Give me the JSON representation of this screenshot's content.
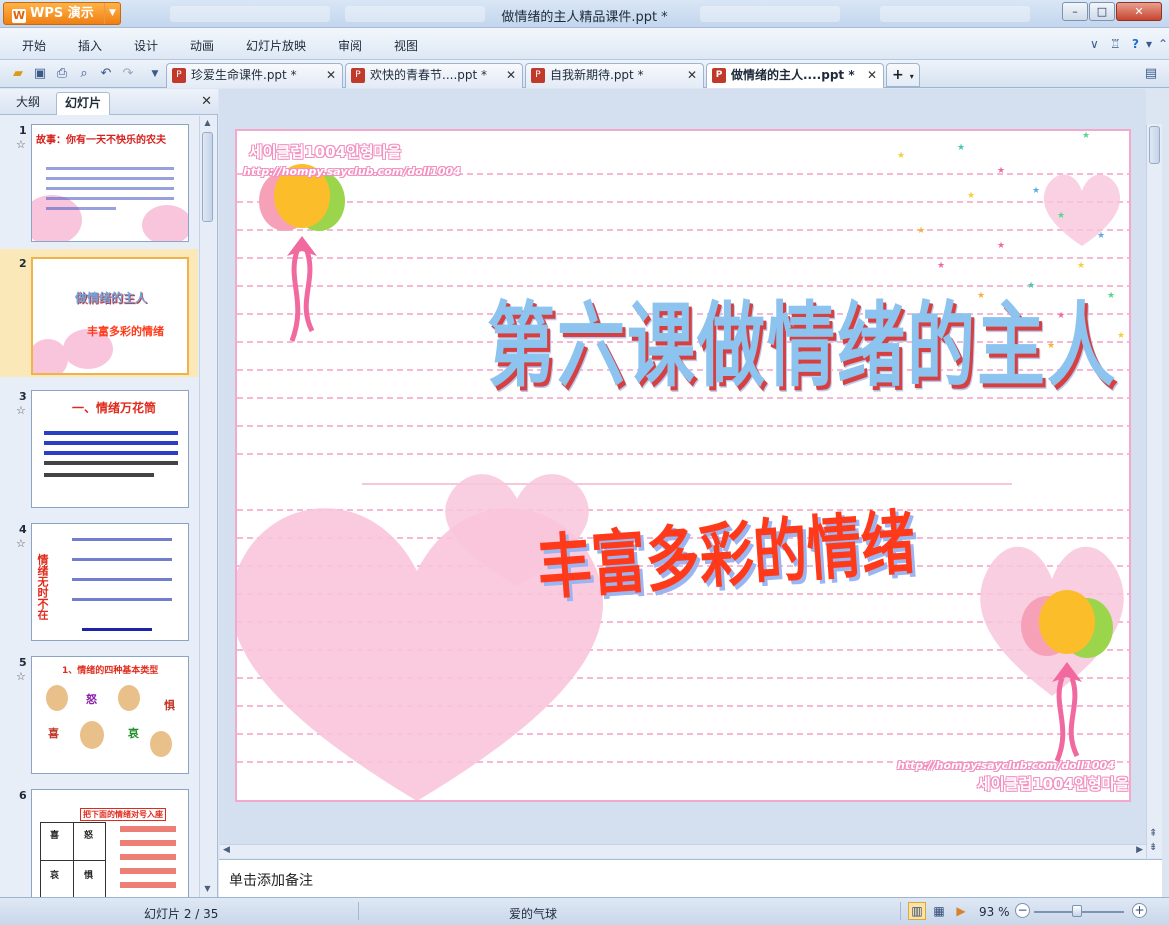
{
  "titlebar": {
    "app_button": "WPS 演示",
    "document_title": "做情绪的主人精品课件.ppt *",
    "minimize": "–",
    "maximize": "□",
    "close": "✕"
  },
  "menu": {
    "items": [
      "开始",
      "插入",
      "设计",
      "动画",
      "幻灯片放映",
      "审阅",
      "视图"
    ]
  },
  "doc_tabs": [
    {
      "label": "珍爱生命课件.ppt *",
      "active": false
    },
    {
      "label": "欢快的青春节....ppt *",
      "active": false
    },
    {
      "label": "自我新期待.ppt *",
      "active": false
    },
    {
      "label": "做情绪的主人....ppt *",
      "active": true
    }
  ],
  "left_panel": {
    "tabs": [
      "大纲",
      "幻灯片"
    ],
    "active_tab": "幻灯片",
    "close": "✕",
    "thumbnails": [
      {
        "num": "1",
        "title": "故事：你有一天不快乐的农夫",
        "selected": false
      },
      {
        "num": "2",
        "title": "做情绪的主人",
        "subtitle": "丰富多彩的情绪",
        "selected": true
      },
      {
        "num": "3",
        "title": "一、情绪万花筒",
        "selected": false
      },
      {
        "num": "4",
        "title": "情绪无时不在",
        "selected": false
      },
      {
        "num": "5",
        "title": "1、情绪的四种基本类型",
        "labels": [
          "怒",
          "惧",
          "喜",
          "哀"
        ],
        "selected": false
      },
      {
        "num": "6",
        "title": "把下面的情绪对号入座",
        "labels": [
          "喜",
          "怒",
          "哀",
          "惧"
        ],
        "selected": false
      }
    ]
  },
  "slide": {
    "title": "第六课做情绪的主人",
    "subtitle": "丰富多彩的情绪",
    "watermark_url": "http://hompy.sayclub.com/doll1004",
    "watermark_korean": "세이클럽1004인형마을"
  },
  "notes": {
    "placeholder": "单击添加备注"
  },
  "status": {
    "slide_counter": "幻灯片 2 / 35",
    "theme": "爱的气球",
    "zoom": "93 %"
  },
  "colors": {
    "accent_orange": "#f07f14",
    "slide_title_blue": "#8cc3ef",
    "slide_subtitle_red": "#ff3a1a",
    "heart_pink": "#f9c5dc"
  }
}
